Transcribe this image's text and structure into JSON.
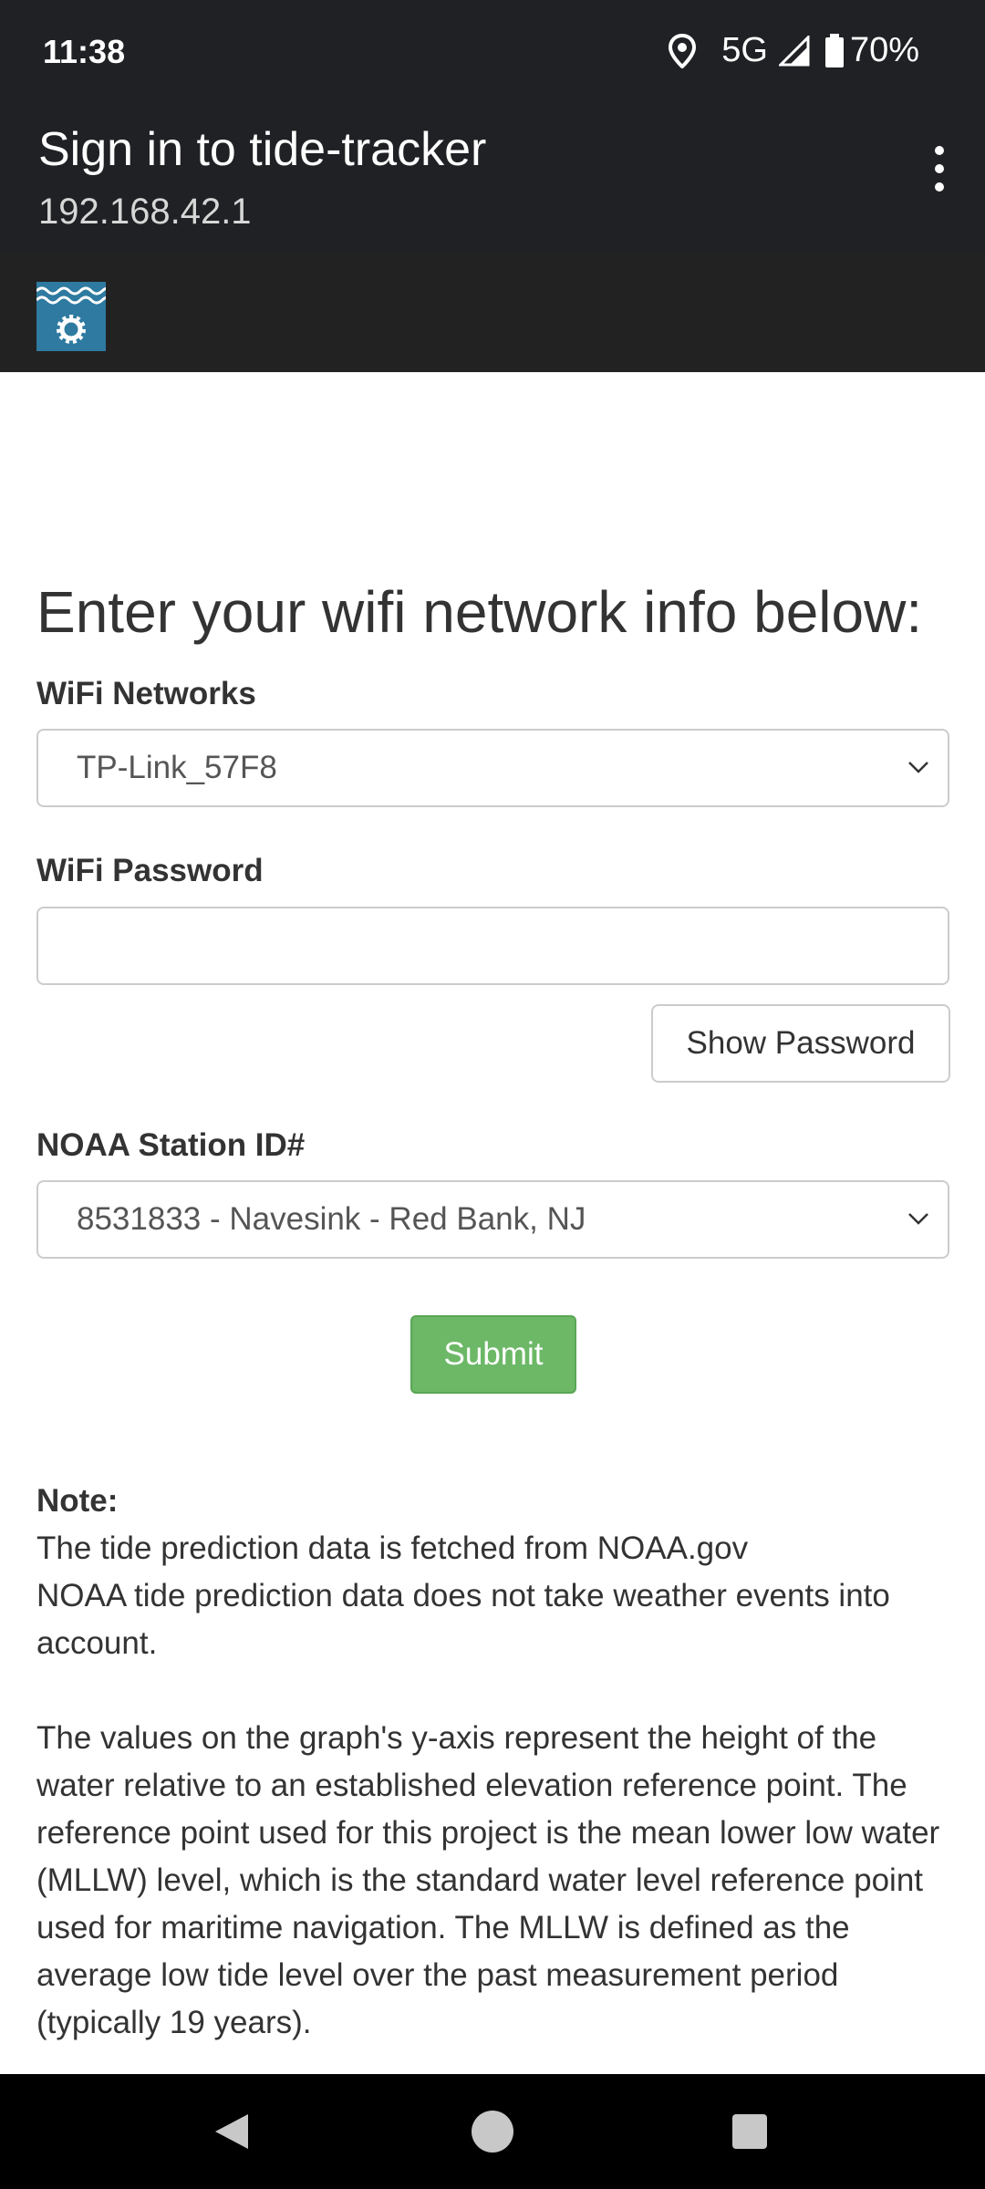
{
  "status": {
    "time": "11:38",
    "network": "5G",
    "battery": "70%"
  },
  "browser": {
    "title": "Sign in to tide-tracker",
    "url": "192.168.42.1"
  },
  "form": {
    "heading": "Enter your wifi network info below:",
    "wifi_label": "WiFi Networks",
    "wifi_selected": "TP-Link_57F8",
    "password_label": "WiFi Password",
    "password_value": "",
    "show_password_label": "Show Password",
    "station_label": "NOAA Station ID#",
    "station_selected": "8531833 - Navesink - Red Bank, NJ",
    "submit_label": "Submit"
  },
  "note": {
    "title": "Note:",
    "line1": "The tide prediction data is fetched from NOAA.gov",
    "line2": "NOAA tide prediction data does not take weather events into account.",
    "paragraph": "The values on the graph's y-axis represent the height of the water relative to an established elevation reference point. The reference point used for this project is the mean lower low water (MLLW) level, which is the standard water level reference point used for maritime navigation. The MLLW is defined as the average low tide level over the past measurement period (typically 19 years)."
  },
  "colors": {
    "accent": "#6cb867",
    "header_bg": "#202124",
    "logo_bg": "#2e7aa0"
  },
  "icons": [
    "location-icon",
    "signal-icon",
    "battery-icon",
    "more-vert-icon",
    "tide-tracker-logo-icon",
    "chevron-down-icon",
    "back-icon",
    "home-icon",
    "recents-icon"
  ]
}
